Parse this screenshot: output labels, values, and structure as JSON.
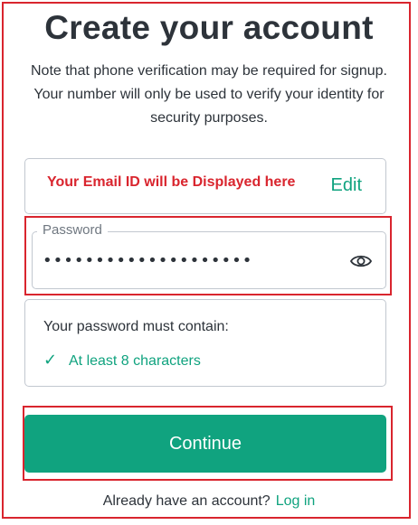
{
  "page": {
    "title": "Create your account",
    "note": "Note that phone verification may be required for signup. Your number will only be used to verify your identity for security purposes."
  },
  "email": {
    "display_text": "Your Email ID will be Displayed here",
    "edit_label": "Edit"
  },
  "password": {
    "label": "Password",
    "value": "••••••••••••••••••••",
    "toggle_icon": "eye-icon"
  },
  "requirements": {
    "title": "Your password must contain:",
    "items": [
      {
        "check_icon": "✓",
        "text": "At least 8 characters"
      }
    ]
  },
  "actions": {
    "continue_label": "Continue",
    "login_prompt": "Already have an account?",
    "login_label": "Log in"
  },
  "colors": {
    "accent": "#10a37f",
    "annotation_red": "#d9252e",
    "text": "#2d333a",
    "border": "#c2c8d0"
  }
}
